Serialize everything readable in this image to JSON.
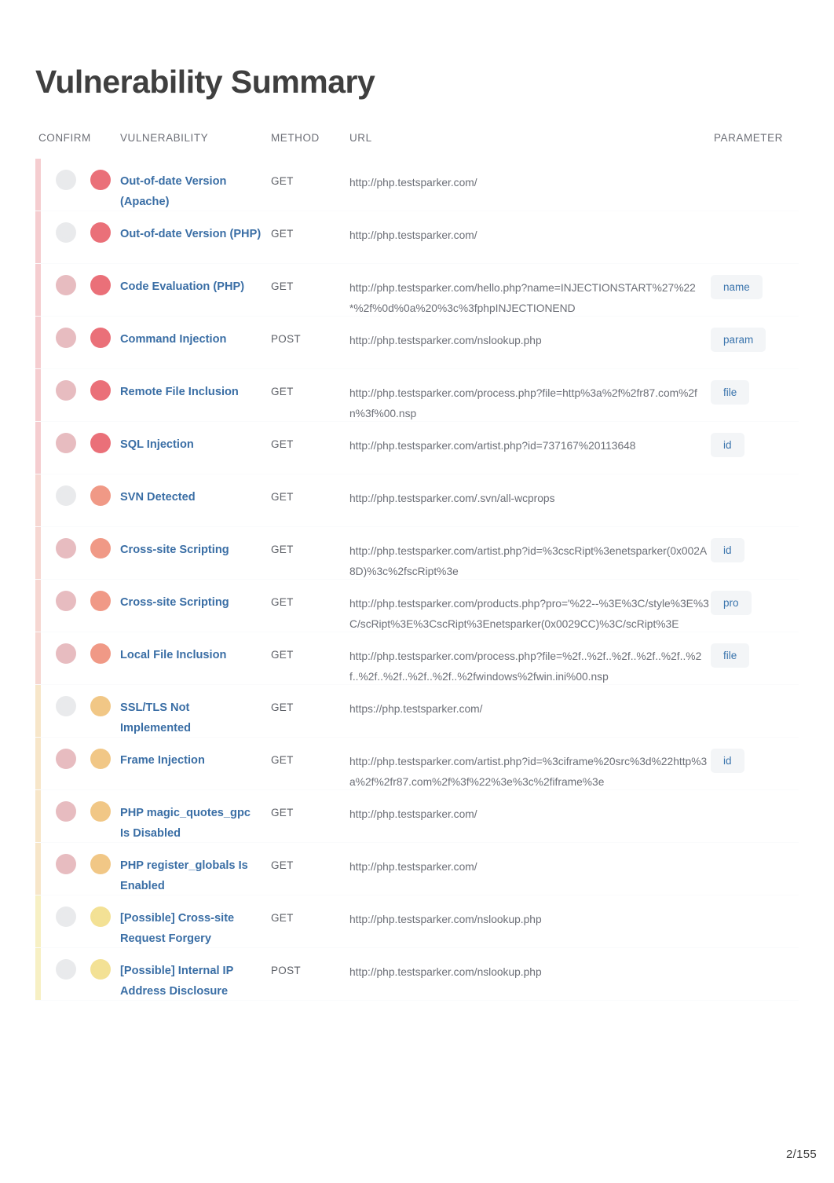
{
  "document": {
    "title": "Vulnerability Summary",
    "page_indicator": "2/155"
  },
  "table": {
    "headers": {
      "confirm": "CONFIRM",
      "vulnerability": "VULNERABILITY",
      "method": "METHOD",
      "url": "URL",
      "parameter": "PARAMETER"
    },
    "severity_colors": {
      "critical": "#e8616b",
      "high": "#ef8f7a",
      "medium": "#f0c27a",
      "low": "#f2de8a",
      "confirm_unconfirmed": "#d8dade",
      "confirm_confirmed": "#e0a6ac",
      "stripe_critical": "#f5cdd0",
      "stripe_high": "#f6d7d2",
      "stripe_medium": "#f7e6c9",
      "stripe_low": "#f7f0c4"
    },
    "rows": [
      {
        "confirm_state": "unconfirmed",
        "severity": "critical",
        "vulnerability": "Out-of-date Version (Apache)",
        "method": "GET",
        "url": "http://php.testsparker.com/",
        "parameter": ""
      },
      {
        "confirm_state": "unconfirmed",
        "severity": "critical",
        "vulnerability": "Out-of-date Version (PHP)",
        "method": "GET",
        "url": "http://php.testsparker.com/",
        "parameter": ""
      },
      {
        "confirm_state": "confirmed",
        "severity": "critical",
        "vulnerability": "Code Evaluation (PHP)",
        "method": "GET",
        "url": "http://php.testsparker.com/hello.php?name=INJECTIONSTART%27%22*%2f%0d%0a%20%3c%3fphpINJECTIONEND",
        "parameter": "name"
      },
      {
        "confirm_state": "confirmed",
        "severity": "critical",
        "vulnerability": "Command Injection",
        "method": "POST",
        "url": "http://php.testsparker.com/nslookup.php",
        "parameter": "param"
      },
      {
        "confirm_state": "confirmed",
        "severity": "critical",
        "vulnerability": "Remote File Inclusion",
        "method": "GET",
        "url": "http://php.testsparker.com/process.php?file=http%3a%2f%2fr87.com%2fn%3f%00.nsp",
        "parameter": "file"
      },
      {
        "confirm_state": "confirmed",
        "severity": "critical",
        "vulnerability": "SQL Injection",
        "method": "GET",
        "url": "http://php.testsparker.com/artist.php?id=737167%20113648",
        "parameter": "id"
      },
      {
        "confirm_state": "unconfirmed",
        "severity": "high",
        "vulnerability": "SVN Detected",
        "method": "GET",
        "url": "http://php.testsparker.com/.svn/all-wcprops",
        "parameter": ""
      },
      {
        "confirm_state": "confirmed",
        "severity": "high",
        "vulnerability": "Cross-site Scripting",
        "method": "GET",
        "url": "http://php.testsparker.com/artist.php?id=%3cscRipt%3enetsparker(0x002A8D)%3c%2fscRipt%3e",
        "parameter": "id"
      },
      {
        "confirm_state": "confirmed",
        "severity": "high",
        "vulnerability": "Cross-site Scripting",
        "method": "GET",
        "url": "http://php.testsparker.com/products.php?pro='%22--%3E%3C/style%3E%3C/scRipt%3E%3CscRipt%3Enetsparker(0x0029CC)%3C/scRipt%3E",
        "parameter": "pro"
      },
      {
        "confirm_state": "confirmed",
        "severity": "high",
        "vulnerability": "Local File Inclusion",
        "method": "GET",
        "url": "http://php.testsparker.com/process.php?file=%2f..%2f..%2f..%2f..%2f..%2f..%2f..%2f..%2f..%2f..%2fwindows%2fwin.ini%00.nsp",
        "parameter": "file"
      },
      {
        "confirm_state": "unconfirmed",
        "severity": "medium",
        "vulnerability": "SSL/TLS Not Implemented",
        "method": "GET",
        "url": "https://php.testsparker.com/",
        "parameter": ""
      },
      {
        "confirm_state": "confirmed",
        "severity": "medium",
        "vulnerability": "Frame Injection",
        "method": "GET",
        "url": "http://php.testsparker.com/artist.php?id=%3ciframe%20src%3d%22http%3a%2f%2fr87.com%2f%3f%22%3e%3c%2fiframe%3e",
        "parameter": "id"
      },
      {
        "confirm_state": "confirmed",
        "severity": "medium",
        "vulnerability": "PHP magic_quotes_gpc Is Disabled",
        "method": "GET",
        "url": "http://php.testsparker.com/",
        "parameter": ""
      },
      {
        "confirm_state": "confirmed",
        "severity": "medium",
        "vulnerability": "PHP register_globals Is Enabled",
        "method": "GET",
        "url": "http://php.testsparker.com/",
        "parameter": ""
      },
      {
        "confirm_state": "unconfirmed",
        "severity": "low",
        "vulnerability": "[Possible] Cross-site Request Forgery",
        "method": "GET",
        "url": "http://php.testsparker.com/nslookup.php",
        "parameter": ""
      },
      {
        "confirm_state": "unconfirmed",
        "severity": "low",
        "vulnerability": "[Possible] Internal IP Address Disclosure",
        "method": "POST",
        "url": "http://php.testsparker.com/nslookup.php",
        "parameter": ""
      }
    ]
  }
}
